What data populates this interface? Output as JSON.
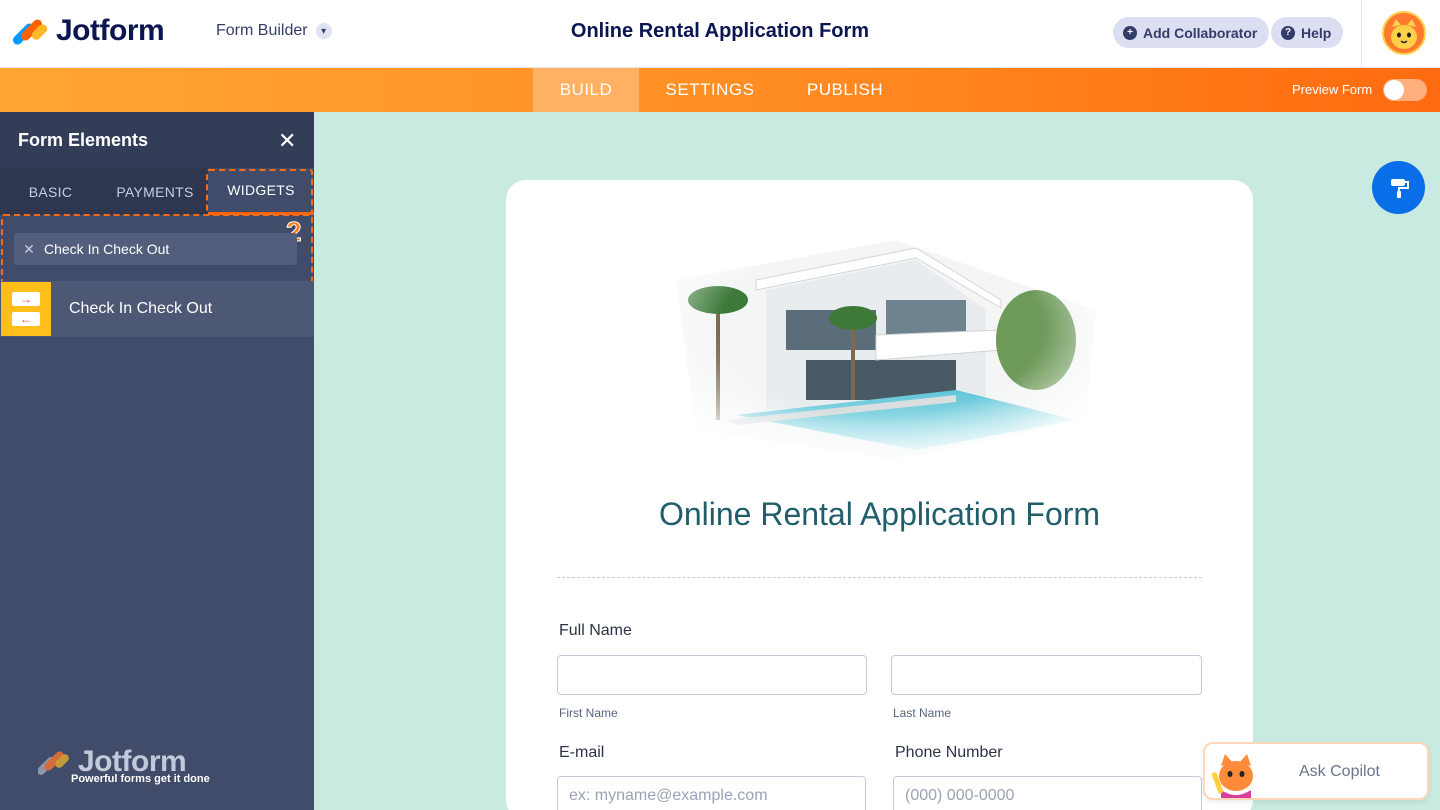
{
  "header": {
    "brand": "Jotform",
    "builder_menu": "Form Builder",
    "form_title": "Online Rental Application Form",
    "add_collaborator": "Add Collaborator",
    "help": "Help"
  },
  "nav": {
    "tabs": [
      {
        "label": "BUILD",
        "active": true
      },
      {
        "label": "SETTINGS",
        "active": false
      },
      {
        "label": "PUBLISH",
        "active": false
      }
    ],
    "preview_label": "Preview Form",
    "preview_enabled": false
  },
  "panel": {
    "title": "Form Elements",
    "tabs": [
      {
        "label": "BASIC",
        "active": false
      },
      {
        "label": "PAYMENTS",
        "active": false
      },
      {
        "label": "WIDGETS",
        "active": true
      }
    ],
    "search_value": "Check In Check Out",
    "step_marker": "2",
    "results": [
      {
        "label": "Check In Check Out",
        "icon": "check-in-check-out-icon"
      }
    ],
    "brand": "Jotform",
    "tagline": "Powerful forms get it done"
  },
  "form": {
    "title": "Online Rental Application Form",
    "full_name_label": "Full Name",
    "first_name_sub": "First Name",
    "last_name_sub": "Last Name",
    "email_label": "E-mail",
    "email_placeholder": "ex: myname@example.com",
    "phone_label": "Phone Number",
    "phone_placeholder": "(000) 000-0000"
  },
  "copilot": {
    "label": "Ask Copilot"
  },
  "colors": {
    "accent": "#ff6100",
    "navy": "#0a1551",
    "canvas_bg": "#c9eae1",
    "panel_bg": "#404c6a",
    "title_teal": "#1f5e6a"
  }
}
